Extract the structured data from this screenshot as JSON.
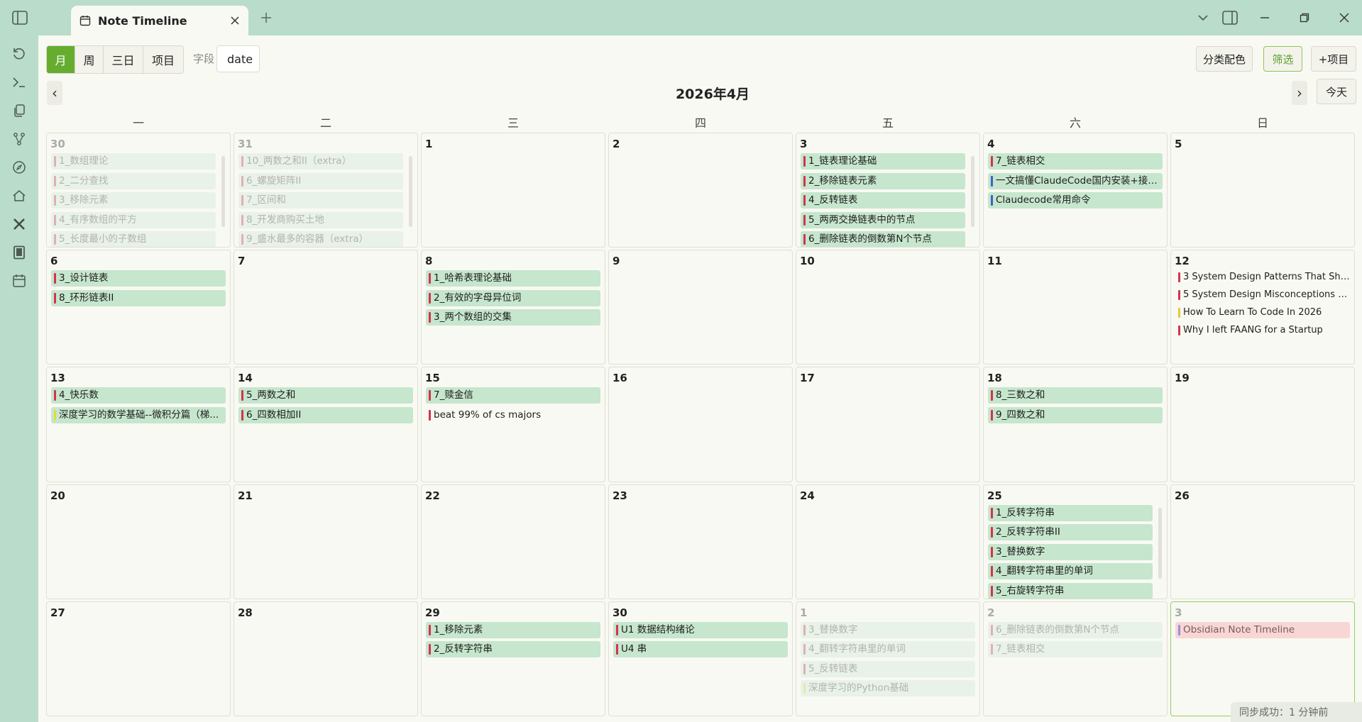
{
  "tab": {
    "title": "Note Timeline"
  },
  "toolbar": {
    "views": [
      "月",
      "周",
      "三日",
      "项目"
    ],
    "active_view": 0,
    "field_label": "字段",
    "field_value": "date",
    "category_color": "分类配色",
    "filter": "筛选",
    "add_project": "+项目",
    "today": "今天"
  },
  "calendar": {
    "month_title": "2026年4月",
    "weekdays": [
      "一",
      "二",
      "三",
      "四",
      "五",
      "六",
      "日"
    ],
    "weeks": [
      [
        {
          "day": "30",
          "outside": true,
          "scroll": true,
          "events": [
            {
              "t": "1_数组理论",
              "c": "#d3344b"
            },
            {
              "t": "2_二分查找",
              "c": "#d3344b"
            },
            {
              "t": "3_移除元素",
              "c": "#d3344b"
            },
            {
              "t": "4_有序数组的平方",
              "c": "#d3344b"
            },
            {
              "t": "5_长度最小的子数组",
              "c": "#d3344b"
            }
          ]
        },
        {
          "day": "31",
          "outside": true,
          "scroll": true,
          "events": [
            {
              "t": "10_两数之和II（extra）",
              "c": "#d3344b"
            },
            {
              "t": "6_螺旋矩阵II",
              "c": "#d3344b"
            },
            {
              "t": "7_区间和",
              "c": "#d3344b"
            },
            {
              "t": "8_开发商购买土地",
              "c": "#d3344b"
            },
            {
              "t": "9_盛水最多的容器（extra）",
              "c": "#d3344b"
            }
          ]
        },
        {
          "day": "1",
          "events": []
        },
        {
          "day": "2",
          "events": []
        },
        {
          "day": "3",
          "scroll": true,
          "events": [
            {
              "t": "1_链表理论基础",
              "c": "#d3344b"
            },
            {
              "t": "2_移除链表元素",
              "c": "#d3344b"
            },
            {
              "t": "4_反转链表",
              "c": "#d3344b"
            },
            {
              "t": "5_两两交换链表中的节点",
              "c": "#d3344b"
            },
            {
              "t": "6_删除链表的倒数第N个节点",
              "c": "#d3344b"
            }
          ]
        },
        {
          "day": "4",
          "events": [
            {
              "t": "7_链表相交",
              "c": "#d3344b"
            },
            {
              "t": "一文搞懂ClaudeCode国内安装+接入...",
              "c": "#3b62c8"
            },
            {
              "t": "Claudecode常用命令",
              "c": "#3b62c8"
            }
          ]
        },
        {
          "day": "5",
          "events": []
        }
      ],
      [
        {
          "day": "6",
          "events": [
            {
              "t": "3_设计链表",
              "c": "#d3344b"
            },
            {
              "t": "8_环形链表II",
              "c": "#d3344b"
            }
          ]
        },
        {
          "day": "7",
          "events": []
        },
        {
          "day": "8",
          "events": [
            {
              "t": "1_哈希表理论基础",
              "c": "#d3344b"
            },
            {
              "t": "2_有效的字母异位词",
              "c": "#d3344b"
            },
            {
              "t": "3_两个数组的交集",
              "c": "#d3344b"
            }
          ]
        },
        {
          "day": "9",
          "events": []
        },
        {
          "day": "10",
          "events": []
        },
        {
          "day": "11",
          "events": []
        },
        {
          "day": "12",
          "compact": true,
          "events": [
            {
              "t": "3 System Design Patterns That Show...",
              "c": "#d3344b",
              "plain": true
            },
            {
              "t": "5 System Design Misconceptions Ev...",
              "c": "#d3344b",
              "plain": true
            },
            {
              "t": "How To Learn To Code In 2026",
              "c": "#e8c73a",
              "plain": true
            },
            {
              "t": "Why I left FAANG for a Startup",
              "c": "#d3344b",
              "plain": true
            }
          ]
        }
      ],
      [
        {
          "day": "13",
          "events": [
            {
              "t": "4_快乐数",
              "c": "#d3344b"
            },
            {
              "t": "深度学习的数学基础--微积分篇（梯...",
              "c": "#e8d83a"
            }
          ]
        },
        {
          "day": "14",
          "events": [
            {
              "t": "5_两数之和",
              "c": "#d3344b"
            },
            {
              "t": "6_四数相加II",
              "c": "#d3344b"
            }
          ]
        },
        {
          "day": "15",
          "events": [
            {
              "t": "7_赎金信",
              "c": "#d3344b"
            },
            {
              "t": "beat 99% of cs majors",
              "c": "#d3344b",
              "plain": true
            }
          ]
        },
        {
          "day": "16",
          "events": []
        },
        {
          "day": "17",
          "events": []
        },
        {
          "day": "18",
          "events": [
            {
              "t": "8_三数之和",
              "c": "#d3344b"
            },
            {
              "t": "9_四数之和",
              "c": "#d3344b"
            }
          ]
        },
        {
          "day": "19",
          "events": []
        }
      ],
      [
        {
          "day": "20",
          "events": []
        },
        {
          "day": "21",
          "events": []
        },
        {
          "day": "22",
          "events": []
        },
        {
          "day": "23",
          "events": []
        },
        {
          "day": "24",
          "events": []
        },
        {
          "day": "25",
          "scroll": true,
          "events": [
            {
              "t": "1_反转字符串",
              "c": "#d3344b"
            },
            {
              "t": "2_反转字符串II",
              "c": "#d3344b"
            },
            {
              "t": "3_替换数字",
              "c": "#d3344b"
            },
            {
              "t": "4_翻转字符串里的单词",
              "c": "#d3344b"
            },
            {
              "t": "5_右旋转字符串",
              "c": "#d3344b"
            }
          ]
        },
        {
          "day": "26",
          "events": []
        }
      ],
      [
        {
          "day": "27",
          "events": []
        },
        {
          "day": "28",
          "events": []
        },
        {
          "day": "29",
          "events": [
            {
              "t": "1_移除元素",
              "c": "#d3344b"
            },
            {
              "t": "2_反转字符串",
              "c": "#d3344b"
            }
          ]
        },
        {
          "day": "30",
          "events": [
            {
              "t": "U1 数据结构绪论",
              "c": "#d3344b"
            },
            {
              "t": "U4 串",
              "c": "#d3344b"
            }
          ]
        },
        {
          "day": "1",
          "outside": true,
          "events": [
            {
              "t": "3_替换数字",
              "c": "#d3344b"
            },
            {
              "t": "4_翻转字符串里的单词",
              "c": "#d3344b"
            },
            {
              "t": "5_反转链表",
              "c": "#d3344b"
            },
            {
              "t": "深度学习的Python基础",
              "c": "#e8d83a"
            }
          ]
        },
        {
          "day": "2",
          "outside": true,
          "events": [
            {
              "t": "6_删除链表的倒数第N个节点",
              "c": "#d3344b"
            },
            {
              "t": "7_链表相交",
              "c": "#d3344b"
            }
          ]
        },
        {
          "day": "3",
          "outside": true,
          "today": true,
          "events": [
            {
              "t": "Obsidian Note Timeline",
              "c": "#9a8fd8",
              "pink": true
            }
          ]
        }
      ]
    ]
  },
  "status": {
    "sync": "同步成功：1 分钟前"
  }
}
